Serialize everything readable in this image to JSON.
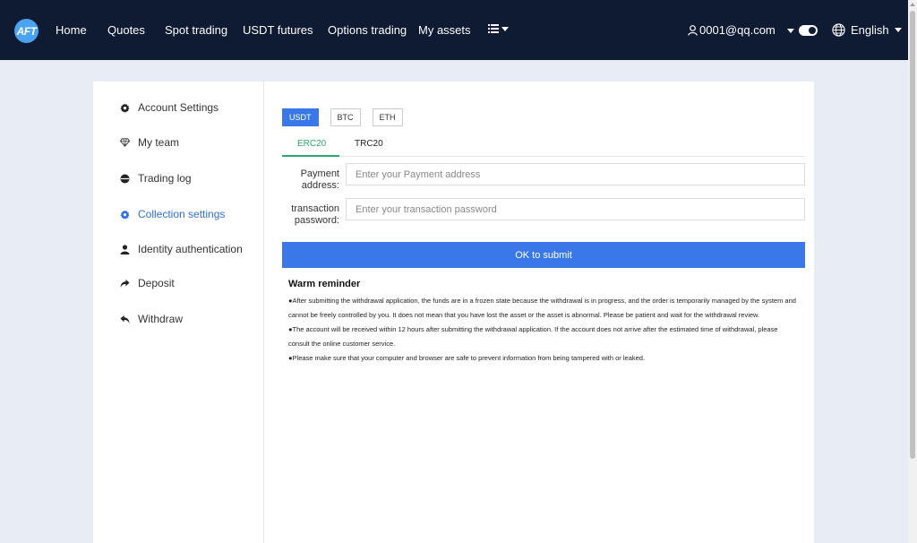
{
  "header": {
    "logo_text": "AFT",
    "nav": [
      "Home",
      "Quotes",
      "Spot trading",
      "USDT futures",
      "Options trading",
      "My assets"
    ],
    "user_email": "0001@qq.com",
    "language": "English"
  },
  "sidebar": {
    "items": [
      {
        "label": "Account Settings",
        "icon": "gear-icon"
      },
      {
        "label": "My team",
        "icon": "diamond-icon"
      },
      {
        "label": "Trading log",
        "icon": "log-icon"
      },
      {
        "label": "Collection settings",
        "icon": "gear-icon",
        "active": true
      },
      {
        "label": "Identity authentication",
        "icon": "user-icon"
      },
      {
        "label": "Deposit",
        "icon": "share-icon"
      },
      {
        "label": "Withdraw",
        "icon": "reply-icon"
      }
    ]
  },
  "coins": [
    "USDT",
    "BTC",
    "ETH"
  ],
  "chains": [
    "ERC20",
    "TRC20"
  ],
  "form": {
    "address_label_1": "Payment",
    "address_label_2": "address:",
    "address_placeholder": "Enter your Payment address",
    "password_label_1": "transaction",
    "password_label_2": "password:",
    "password_placeholder": "Enter your transaction password",
    "submit_label": "OK to submit"
  },
  "reminder": {
    "title": "Warm reminder",
    "lines": [
      "●After submitting the withdrawal application, the funds are in a frozen state because the withdrawal is in progress, and the order is temporarily managed by the system and cannot be freely controlled by you. It does not mean that you have lost the asset or the asset is abnormal. Please be patient and wait for the withdrawal review.",
      "●The account will be received within 12 hours after submitting the withdrawal application. If the account does not arrive after the estimated time of withdrawal, please consult the online customer service.",
      "●Please make sure that your computer and browser are safe to prevent information from being tampered with or leaked."
    ]
  },
  "colors": {
    "header_bg": "#0f1a33",
    "accent": "#3a78ea",
    "tab_active": "#2aa86a",
    "page_bg": "#e8edf5"
  }
}
